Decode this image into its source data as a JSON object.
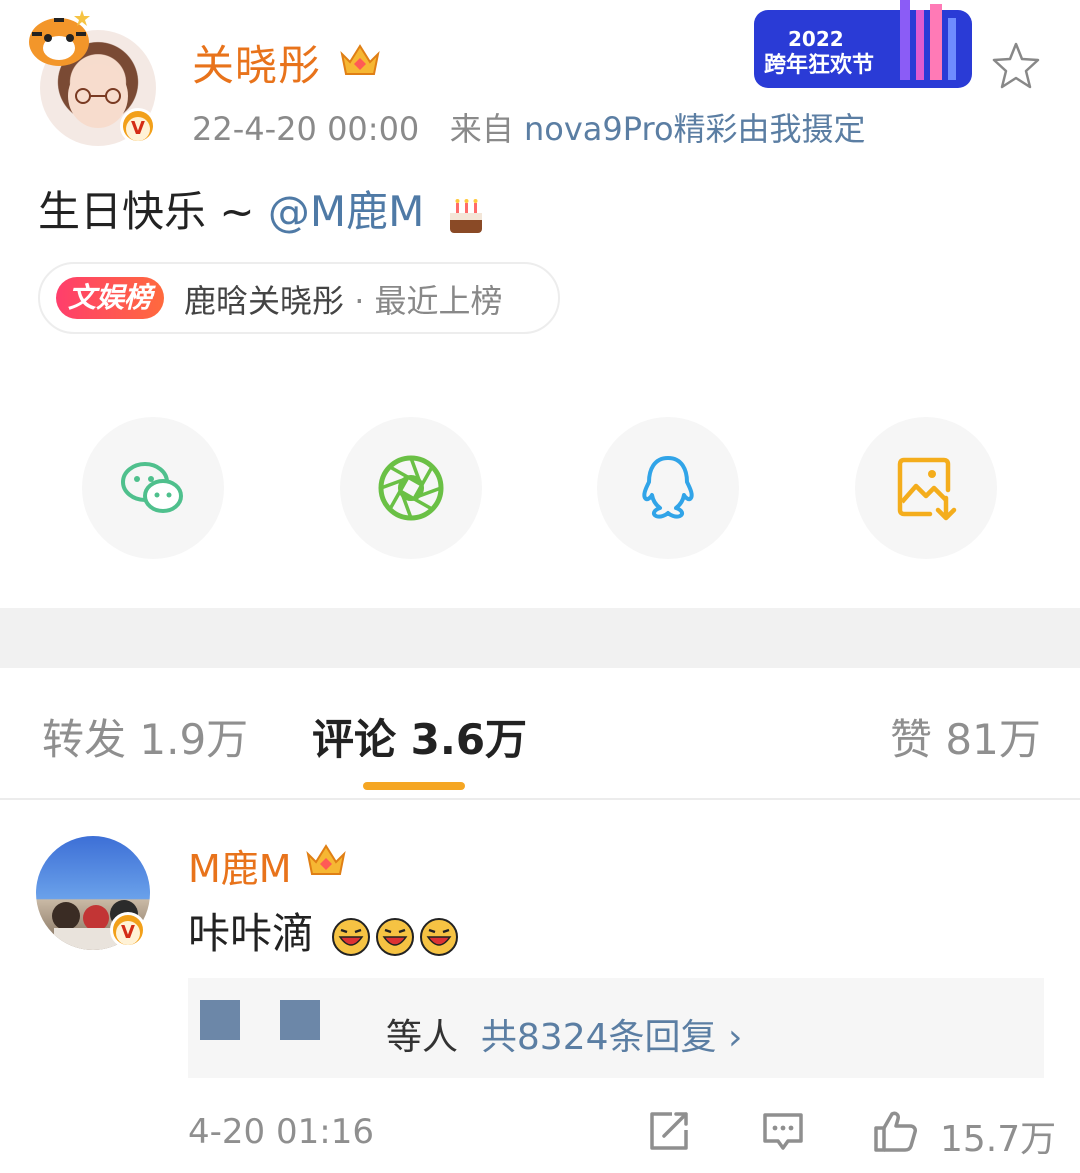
{
  "post": {
    "username": "关晓彤",
    "timestamp": "22-4-20 00:00",
    "source_prefix": "来自",
    "source": "nova9Pro精彩由我摄定",
    "text": "生日快乐 ~ ",
    "mention": "@M鹿M",
    "promo_year": "2022",
    "promo_text": "跨年狂欢节"
  },
  "rank": {
    "tag": "文娱榜",
    "topic": "鹿晗关晓彤",
    "suffix": " · 最近上榜"
  },
  "share": {
    "icons": [
      "wechat-icon",
      "moments-icon",
      "qq-icon",
      "save-image-icon"
    ],
    "colors": {
      "wechat": "#4fc08d",
      "moments": "#6ac045",
      "qq": "#31a4e8",
      "save": "#f4ad1c"
    }
  },
  "tabs": [
    {
      "label": "转发",
      "count": "1.9万"
    },
    {
      "label": "评论",
      "count": "3.6万"
    },
    {
      "label": "赞",
      "count": "81万"
    }
  ],
  "comment": {
    "username": "M鹿M",
    "text": "咔咔滴",
    "reply_partial": "等人",
    "reply_link": "共8324条回复",
    "reply_chevron": "›",
    "time": "4-20 01:16",
    "likes": "15.7万"
  },
  "colors": {
    "username": "#e8731b",
    "link": "#5b7ea3",
    "accent": "#f5a623"
  }
}
